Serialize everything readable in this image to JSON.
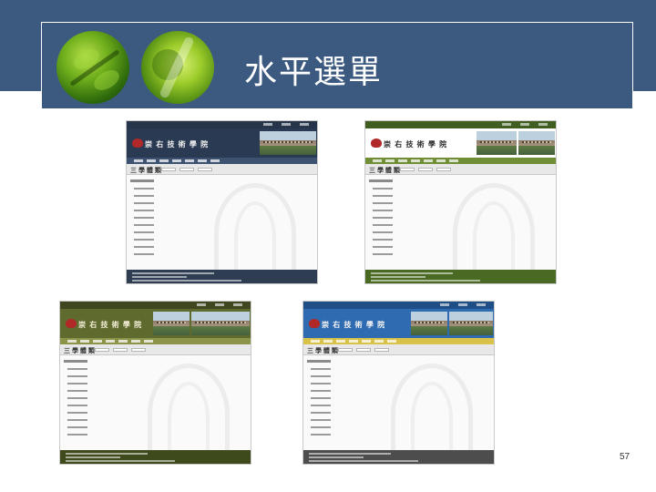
{
  "slide": {
    "title": "水平選單",
    "page_number": "57"
  },
  "screenshots": [
    {
      "variant": "dark-blue",
      "topbar_color": "#27354a",
      "header_color": "#2a3a52",
      "brand_color": "#f2f2f2",
      "menu_color": "#3d5170",
      "footer_color": "#2f3d52",
      "tab_title": "三 學 體 類",
      "brand": "崇 右 技 術 學 院"
    },
    {
      "variant": "white-green",
      "topbar_color": "#3f5e1f",
      "header_color": "#ffffff",
      "brand_color": "#2b2b2b",
      "menu_color": "#6f8e36",
      "footer_color": "#4a6a23",
      "tab_title": "三 學 體 類",
      "brand": "崇 右 技 術 學 院"
    },
    {
      "variant": "olive-green",
      "topbar_color": "#3f4620",
      "header_color": "#5f6a2e",
      "brand_color": "#f4f0d8",
      "menu_color": "#8b9448",
      "footer_color": "#3f4a1c",
      "tab_title": "三 學 體 類",
      "brand": "崇 右 技 術 學 院"
    },
    {
      "variant": "blue",
      "topbar_color": "#1f4f86",
      "header_color": "#2e6bb0",
      "brand_color": "#f4f4f4",
      "menu_color": "#d8c24a",
      "footer_color": "#4d4d4d",
      "tab_title": "三 學 體 類",
      "brand": "崇 右 技 術 學 院"
    }
  ]
}
